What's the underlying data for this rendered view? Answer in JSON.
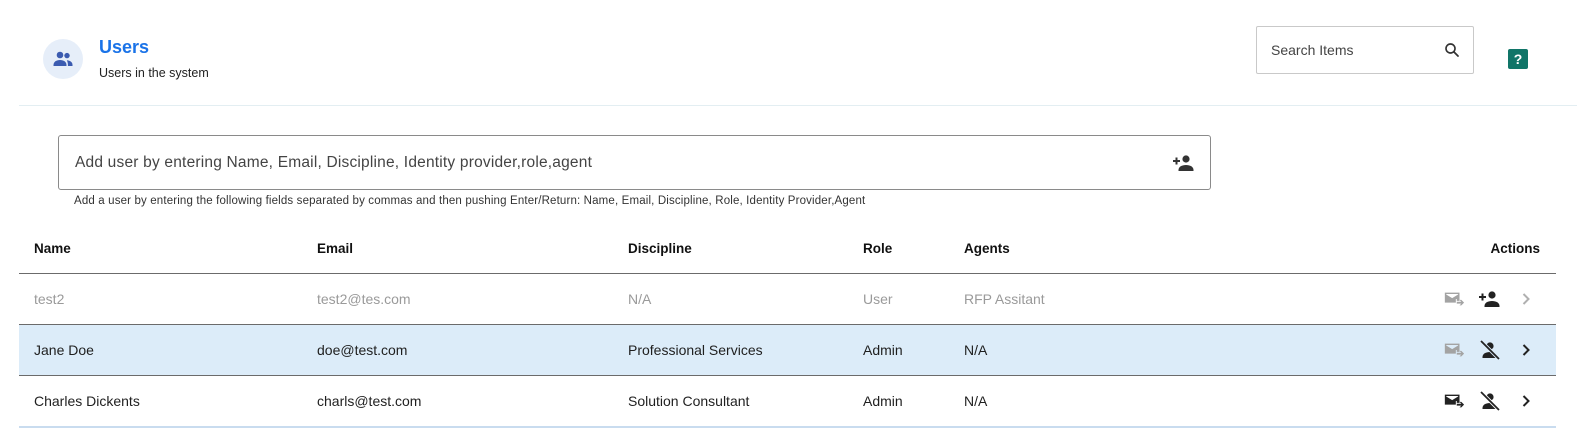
{
  "header": {
    "title": "Users",
    "subtitle": "Users in the system",
    "search_placeholder": "Search Items",
    "help_label": "?"
  },
  "add_user": {
    "placeholder": "Add user by entering Name, Email, Discipline, Identity provider,role,agent",
    "hint": "Add a user by entering the following fields separated by commas and then pushing Enter/Return: Name, Email, Discipline, Role, Identity Provider,Agent"
  },
  "table": {
    "columns": [
      "Name",
      "Email",
      "Discipline",
      "Role",
      "Agents",
      "Actions"
    ],
    "rows": [
      {
        "name": "test2",
        "email": "test2@tes.com",
        "discipline": "N/A",
        "role": "User",
        "agents": "RFP Assitant",
        "state": "disabled",
        "actions": [
          "send-email-icon",
          "add-user-icon",
          "chevron-right-icon"
        ]
      },
      {
        "name": "Jane Doe",
        "email": "doe@test.com",
        "discipline": "Professional Services",
        "role": "Admin",
        "agents": "N/A",
        "state": "selected",
        "actions": [
          "send-email-icon",
          "remove-user-icon",
          "chevron-right-icon"
        ]
      },
      {
        "name": "Charles Dickents",
        "email": "charls@test.com",
        "discipline": "Solution Consultant",
        "role": "Admin",
        "agents": "N/A",
        "state": "normal",
        "actions": [
          "send-email-icon",
          "remove-user-icon",
          "chevron-right-icon"
        ]
      }
    ]
  },
  "colors": {
    "accent": "#1a73e8",
    "help": "#107568",
    "selected_row": "#dcecf9"
  }
}
